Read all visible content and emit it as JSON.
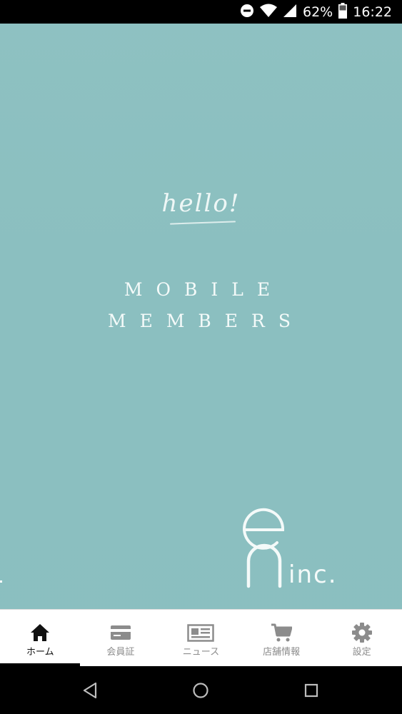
{
  "status_bar": {
    "battery_percent": "62%",
    "time": "16:22",
    "icons": [
      "do-not-disturb-icon",
      "wifi-icon",
      "cell-signal-icon",
      "battery-icon"
    ]
  },
  "hero": {
    "greeting": "hello!",
    "title_line1": "MOBILE",
    "title_line2": "MEMBERS",
    "logo_suffix": "inc.",
    "background_color": "#8bbfc0"
  },
  "bottom_nav": {
    "active_index": 0,
    "items": [
      {
        "label": "ホーム",
        "icon": "home-icon"
      },
      {
        "label": "会員証",
        "icon": "card-icon"
      },
      {
        "label": "ニュース",
        "icon": "news-icon"
      },
      {
        "label": "店舗情報",
        "icon": "cart-icon"
      },
      {
        "label": "設定",
        "icon": "gear-icon"
      }
    ]
  },
  "system_nav": {
    "buttons": [
      "back-icon",
      "home-circle-icon",
      "recents-icon"
    ]
  }
}
